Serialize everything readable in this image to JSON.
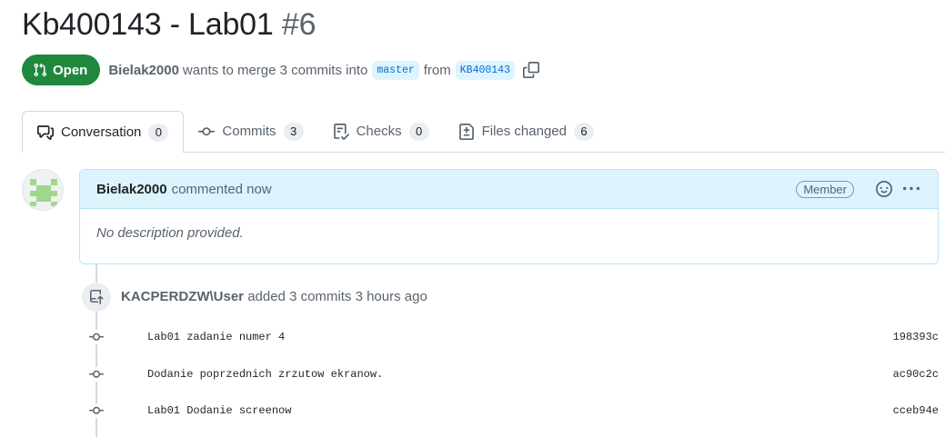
{
  "pr": {
    "title": "Kb400143 - Lab01",
    "number": "#6",
    "state": "Open",
    "author": "Bielak2000",
    "merge_text_1": "wants to merge 3 commits into",
    "base_branch": "master",
    "merge_text_2": "from",
    "head_branch": "KB400143"
  },
  "tabs": [
    {
      "label": "Conversation",
      "count": "0",
      "icon": "comment-discussion-icon"
    },
    {
      "label": "Commits",
      "count": "3",
      "icon": "git-commit-icon"
    },
    {
      "label": "Checks",
      "count": "0",
      "icon": "checklist-icon"
    },
    {
      "label": "Files changed",
      "count": "6",
      "icon": "file-diff-icon"
    }
  ],
  "comment": {
    "author": "Bielak2000",
    "action": "commented now",
    "badge": "Member",
    "body": "No description provided."
  },
  "event": {
    "actor": "KACPERDZW\\User",
    "text": "added 3 commits 3 hours ago"
  },
  "commits": [
    {
      "message": "Lab01 zadanie numer 4",
      "sha": "198393c"
    },
    {
      "message": "Dodanie poprzednich zrzutow ekranow.",
      "sha": "ac90c2c"
    },
    {
      "message": "Lab01 Dodanie screenow",
      "sha": "cceb94e"
    }
  ],
  "colors": {
    "open_green": "#1f883d",
    "branch_blue": "#0969da",
    "header_blue": "#ddf4ff",
    "avatar_green": "#9fd88b"
  }
}
